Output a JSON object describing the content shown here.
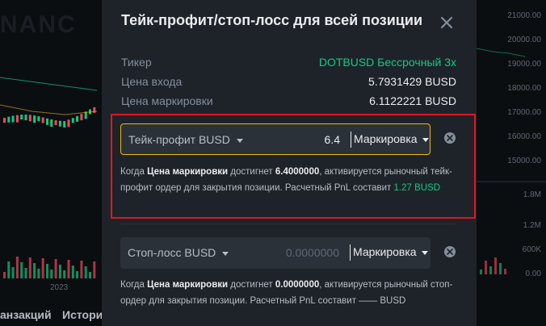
{
  "background": {
    "brand_fragment": "NANC",
    "price_axis": [
      "21000.00",
      "20000.00",
      "19000.00",
      "18000.00",
      "17000.00",
      "16000.00",
      "15000.00"
    ],
    "volume_axis": [
      "1.8M",
      "1.2M",
      "600K",
      "0.00"
    ],
    "year_label": "2023",
    "bottom_tabs": [
      "анзакций",
      "Истори"
    ]
  },
  "modal": {
    "title": "Тейк-профит/стоп-лосс для всей позиции",
    "close_icon": "close-icon",
    "ticker_label": "Тикер",
    "ticker_value": "DOTBUSD Бессрочный 3x",
    "entry_label": "Цена входа",
    "entry_value": "5.7931429 BUSD",
    "mark_label": "Цена маркировки",
    "mark_value": "6.1122221 BUSD",
    "take_profit": {
      "label": "Тейк-профит BUSD",
      "value": "6.4",
      "price_type": "Маркировка",
      "desc_prefix": "Когда ",
      "desc_bold": "Цена маркировки",
      "desc_mid": " достигнет ",
      "desc_price": "6.4000000",
      "desc_suffix": ", активируется рыночный тейк-профит ордер для закрытия позиции. Расчетный PnL составит ",
      "desc_pnl": "1.27 BUSD"
    },
    "stop_loss": {
      "label": "Стоп-лосс BUSD",
      "placeholder": "0.0000000",
      "price_type": "Маркировка",
      "desc_prefix": "Когда ",
      "desc_bold": "Цена маркировки",
      "desc_mid": " достигнет ",
      "desc_price": "0.0000000",
      "desc_suffix": ", активируется рыночный стоп-ордер для закрытия позиции. Расчетный PnL составит —— BUSD"
    }
  },
  "colors": {
    "accent_yellow": "#f0b90b",
    "positive_green": "#0ecb81",
    "highlight_red": "#e0161e",
    "candle_red": "#f6465d",
    "modal_bg": "#1e2329"
  }
}
